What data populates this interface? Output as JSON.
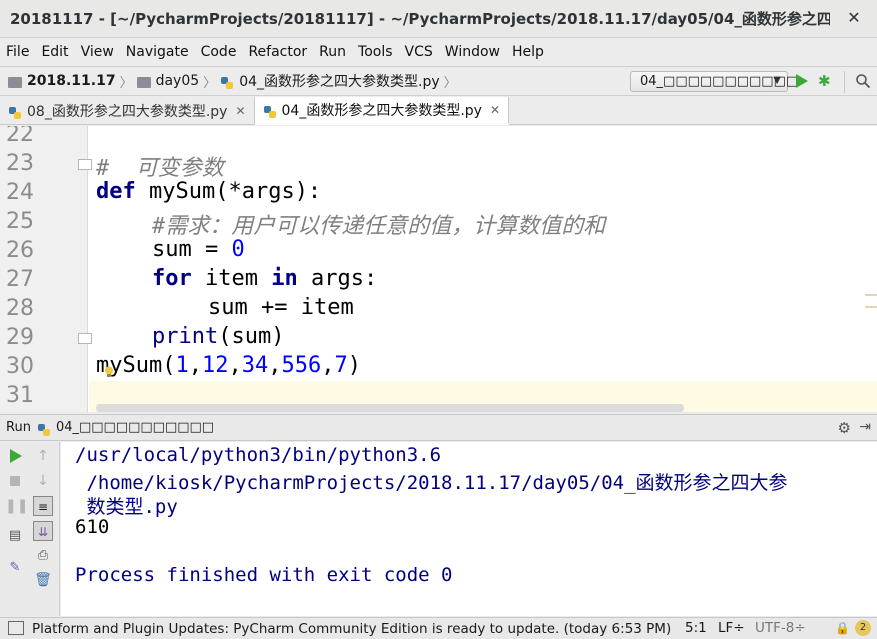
{
  "window": {
    "title": "20181117 - [~/PycharmProjects/20181117] - ~/PycharmProjects/2018.11.17/day05/04_函数形参之四..."
  },
  "menu": {
    "items": [
      "File",
      "Edit",
      "View",
      "Navigate",
      "Code",
      "Refactor",
      "Run",
      "Tools",
      "VCS",
      "Window",
      "Help"
    ]
  },
  "navbar": {
    "crumbs": [
      "2018.11.17",
      "day05",
      "04_函数形参之四大参数类型.py"
    ],
    "run_config": "04_□□□□□□□□□□□"
  },
  "tabs": [
    {
      "label": "08_函数形参之四大参数类型.py",
      "active": false
    },
    {
      "label": "04_函数形参之四大参数类型.py",
      "active": true
    }
  ],
  "editor": {
    "line_numbers": [
      "22",
      "23",
      "24",
      "25",
      "26",
      "27",
      "28",
      "29",
      "30",
      "31"
    ],
    "lines": {
      "l23": "#  可变参数",
      "l24_kw": "def",
      "l24_rest": " mySum(*args):",
      "l25": "#需求：用户可以传递任意的值，计算数值的和",
      "l26_a": "sum = ",
      "l26_num": "0",
      "l27_kw1": "for",
      "l27_mid": " item ",
      "l27_kw2": "in",
      "l27_rest": " args:",
      "l28": "sum += item",
      "l29_fn": "print",
      "l29_rest": "(sum)",
      "l30_fn": "mySum(",
      "l30_n1": "1",
      "l30_n2": "12",
      "l30_n3": "34",
      "l30_n4": "556",
      "l30_n5": "7",
      "comma": ",",
      "close": ")"
    }
  },
  "run_panel": {
    "label": "Run",
    "config": "04_□□□□□□□□□□□",
    "output": {
      "line1": "/usr/local/python3/bin/python3.6",
      "line2": " /home/kiosk/PycharmProjects/2018.11.17/day05/04_函数形参之四大参",
      "line3": " 数类型.py",
      "line4": "610",
      "line5": "Process finished with exit code 0"
    }
  },
  "statusbar": {
    "message": "Platform and Plugin Updates: PyCharm Community Edition is ready to update. (today 6:53 PM)",
    "position": "5:1",
    "line_sep": "LF÷",
    "encoding": "UTF-8÷",
    "badge": "2"
  }
}
